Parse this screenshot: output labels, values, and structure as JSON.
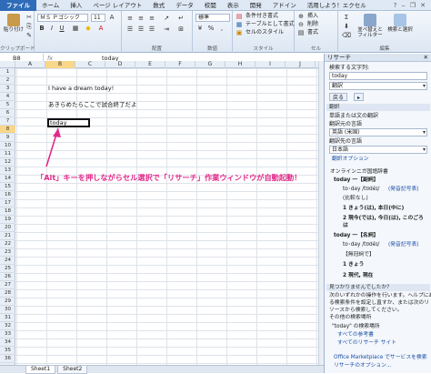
{
  "ribbon_tabs": [
    "ファイル",
    "ホーム",
    "挿入",
    "ページ レイアウト",
    "数式",
    "データ",
    "校閲",
    "表示",
    "開発",
    "アドイン",
    "活用しよう！エクセル"
  ],
  "ribbon": {
    "paste_label": "貼り付け",
    "clipboard_group": "クリップボード",
    "font_name": "ＭＳ Ｐゴシック",
    "font_size": "11",
    "alignment_group": "配置",
    "number_format": "標準",
    "number_group": "数値",
    "cond_format": "条件付き書式",
    "table_format": "テーブルとして書式",
    "cell_style": "セルのスタイル",
    "style_group": "スタイル",
    "insert": "挿入",
    "delete": "削除",
    "format": "書式",
    "cells_group": "セル",
    "sort_filter": "並べ替えとフィルター",
    "find_select": "検索と選択",
    "edit_group": "編集"
  },
  "formula_bar": {
    "name_box": "B8",
    "fx": "fx",
    "value": "today"
  },
  "columns": [
    "A",
    "B",
    "C",
    "D",
    "E",
    "F",
    "G",
    "H",
    "I",
    "J"
  ],
  "selected_column": "B",
  "rows": [
    "1",
    "2",
    "3",
    "4",
    "5",
    "6",
    "7",
    "8",
    "9",
    "10",
    "11",
    "12",
    "13",
    "14",
    "15",
    "16",
    "17",
    "18",
    "19",
    "20",
    "21",
    "22",
    "23",
    "24",
    "25",
    "26",
    "27",
    "28",
    "29",
    "30",
    "31",
    "32",
    "33",
    "34",
    "35",
    "36"
  ],
  "selected_row": "8",
  "cells": {
    "b3": "I have a dream today!",
    "b5": "あきらめたらここで試合終了だよ",
    "b8": "today"
  },
  "annotation": "「Alt」キーを押しながらセル選択で「リサーチ」作業ウィンドウが自動起動！",
  "sheet_tabs": [
    "Sheet1",
    "Sheet2"
  ],
  "research": {
    "title": "リサーチ",
    "search_label": "検索する文字列:",
    "search_value": "today",
    "service": "翻訳",
    "back_button": "戻る",
    "section_translate": "翻訳",
    "word_label": "単語または文の翻訳",
    "source_label": "翻訳元の言語",
    "source_value": "英語 (米国)",
    "target_label": "翻訳先の言語",
    "target_value": "日本語",
    "options_link": "翻訳オプション",
    "dict_name": "オンラインニガ国語辞書",
    "entry1_head": "today  一【副詞】",
    "entry1_pron": "to･day /tʊdéɪ/",
    "entry1_pron_link": "(発音記号表)",
    "entry1_note": "(比較なし)",
    "entry1_sense1": "1 きょう(は), 本日(中に)",
    "entry1_sense2": "2 現今(では), 今日(は), このごろ",
    "entry1_sense2b": "は",
    "entry2_head": "today  一【名詞】",
    "entry2_pron": "to･day /tʊdéɪ/",
    "entry2_pron_link": "(発音記号表)",
    "entry2_note": "【無冠詞で】",
    "entry2_sense1": "1 きょう",
    "entry2_sense2": "2 現代, 現在",
    "not_found": "見つかりませんでしたか?",
    "help_text": [
      "次のいずれかの操作を行います。ヘルプにあ",
      "る検索条件を設定し直すか、または次のリ",
      "ソースから検索してください。",
      "その他の検索場所"
    ],
    "other_places_label": "\"today\" の検索場所",
    "all_books": "すべての参考書",
    "all_sites": "すべてのリサーチ サイト",
    "marketplace": "Office Marketplace でサービスを検索",
    "research_options": "リサーチのオプション..."
  },
  "colors": {
    "accent": "#2e6bb8",
    "annotation": "#e22a8a",
    "selected": "#f8d68a"
  }
}
